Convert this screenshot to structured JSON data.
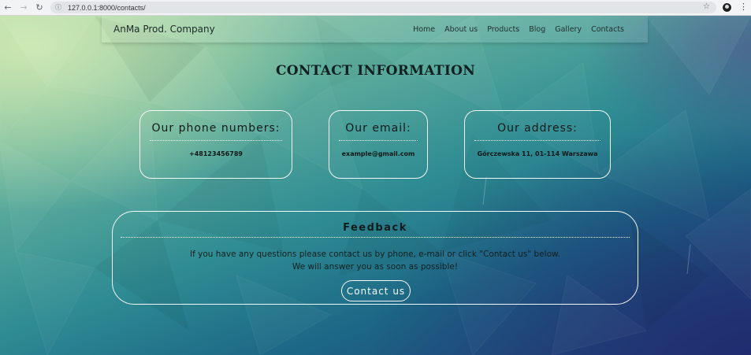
{
  "browser": {
    "url": "127.0.0.1:8000/contacts/",
    "back_icon": "←",
    "forward_icon": "→",
    "reload_icon": "↻",
    "info_icon": "ⓘ",
    "star_icon": "☆",
    "menu_icon": "⋮"
  },
  "navbar": {
    "brand": "AnMa Prod. Company",
    "links": [
      "Home",
      "About us",
      "Products",
      "Blog",
      "Gallery",
      "Contacts"
    ]
  },
  "page": {
    "title": "CONTACT INFORMATION"
  },
  "cards": [
    {
      "title": "Our phone numbers:",
      "value": "+48123456789"
    },
    {
      "title": "Our email:",
      "value": "example@gmail.com"
    },
    {
      "title": "Our address:",
      "value": "Górczewska 11, 01-114 Warszawa"
    }
  ],
  "feedback": {
    "title": "Feedback",
    "line1": "If you have any questions please contact us by phone, e-mail or click \"Contact us\" below.",
    "line2": "We will answer you as soon as possible!",
    "button": "Contact  us"
  }
}
